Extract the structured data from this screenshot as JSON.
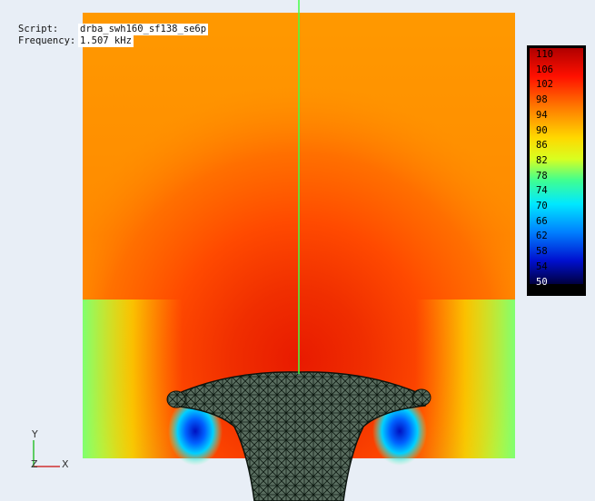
{
  "info": {
    "script_label": "Script:",
    "script_value": "drba_swh160_sf138_se6p",
    "frequency_label": "Frequency:",
    "frequency_value": "1.507 kHz"
  },
  "legend": {
    "labels": [
      "110",
      "106",
      "102",
      "98",
      "94",
      "90",
      "86",
      "82",
      "78",
      "74",
      "70",
      "66",
      "62",
      "58",
      "54",
      "50"
    ],
    "min": 50,
    "max": 110
  },
  "axes": {
    "y": "Y",
    "z": "Z",
    "x": "X"
  },
  "colors": {
    "background": "#e8eef6",
    "axis_line": "#33ff33"
  }
}
